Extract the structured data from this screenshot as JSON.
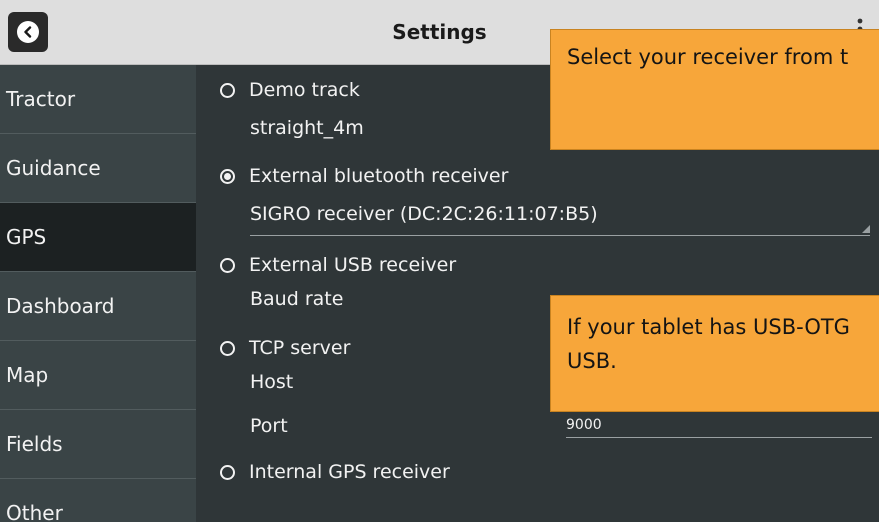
{
  "header": {
    "title": "Settings"
  },
  "sidebar": {
    "items": [
      {
        "label": "Tractor"
      },
      {
        "label": "Guidance"
      },
      {
        "label": "GPS",
        "active": true
      },
      {
        "label": "Dashboard"
      },
      {
        "label": "Map"
      },
      {
        "label": "Fields"
      },
      {
        "label": "Other"
      }
    ]
  },
  "gps": {
    "demo_track": {
      "label": "Demo track",
      "value": "straight_4m",
      "selected": false
    },
    "bluetooth": {
      "label": "External bluetooth receiver",
      "selected_device": "SIGRO receiver (DC:2C:26:11:07:B5)",
      "selected": true
    },
    "usb": {
      "label": "External USB receiver",
      "baud_rate_label": "Baud rate",
      "selected": false
    },
    "tcp": {
      "label": "TCP server",
      "host_label": "Host",
      "port_label": "Port",
      "port_value": "9000",
      "selected": false
    },
    "internal": {
      "label": "Internal GPS receiver",
      "selected": false
    }
  },
  "tooltips": {
    "receiver": "Select your receiver from t",
    "usb_line1": "If your tablet has USB-OTG",
    "usb_line2": "USB."
  },
  "colors": {
    "tooltip_bg": "#f7a63a",
    "sidebar_active": "#1c2122",
    "content_bg": "#2f3638"
  },
  "icons": {
    "back": "chevron-left-icon",
    "menu": "vertical-dots-icon"
  }
}
